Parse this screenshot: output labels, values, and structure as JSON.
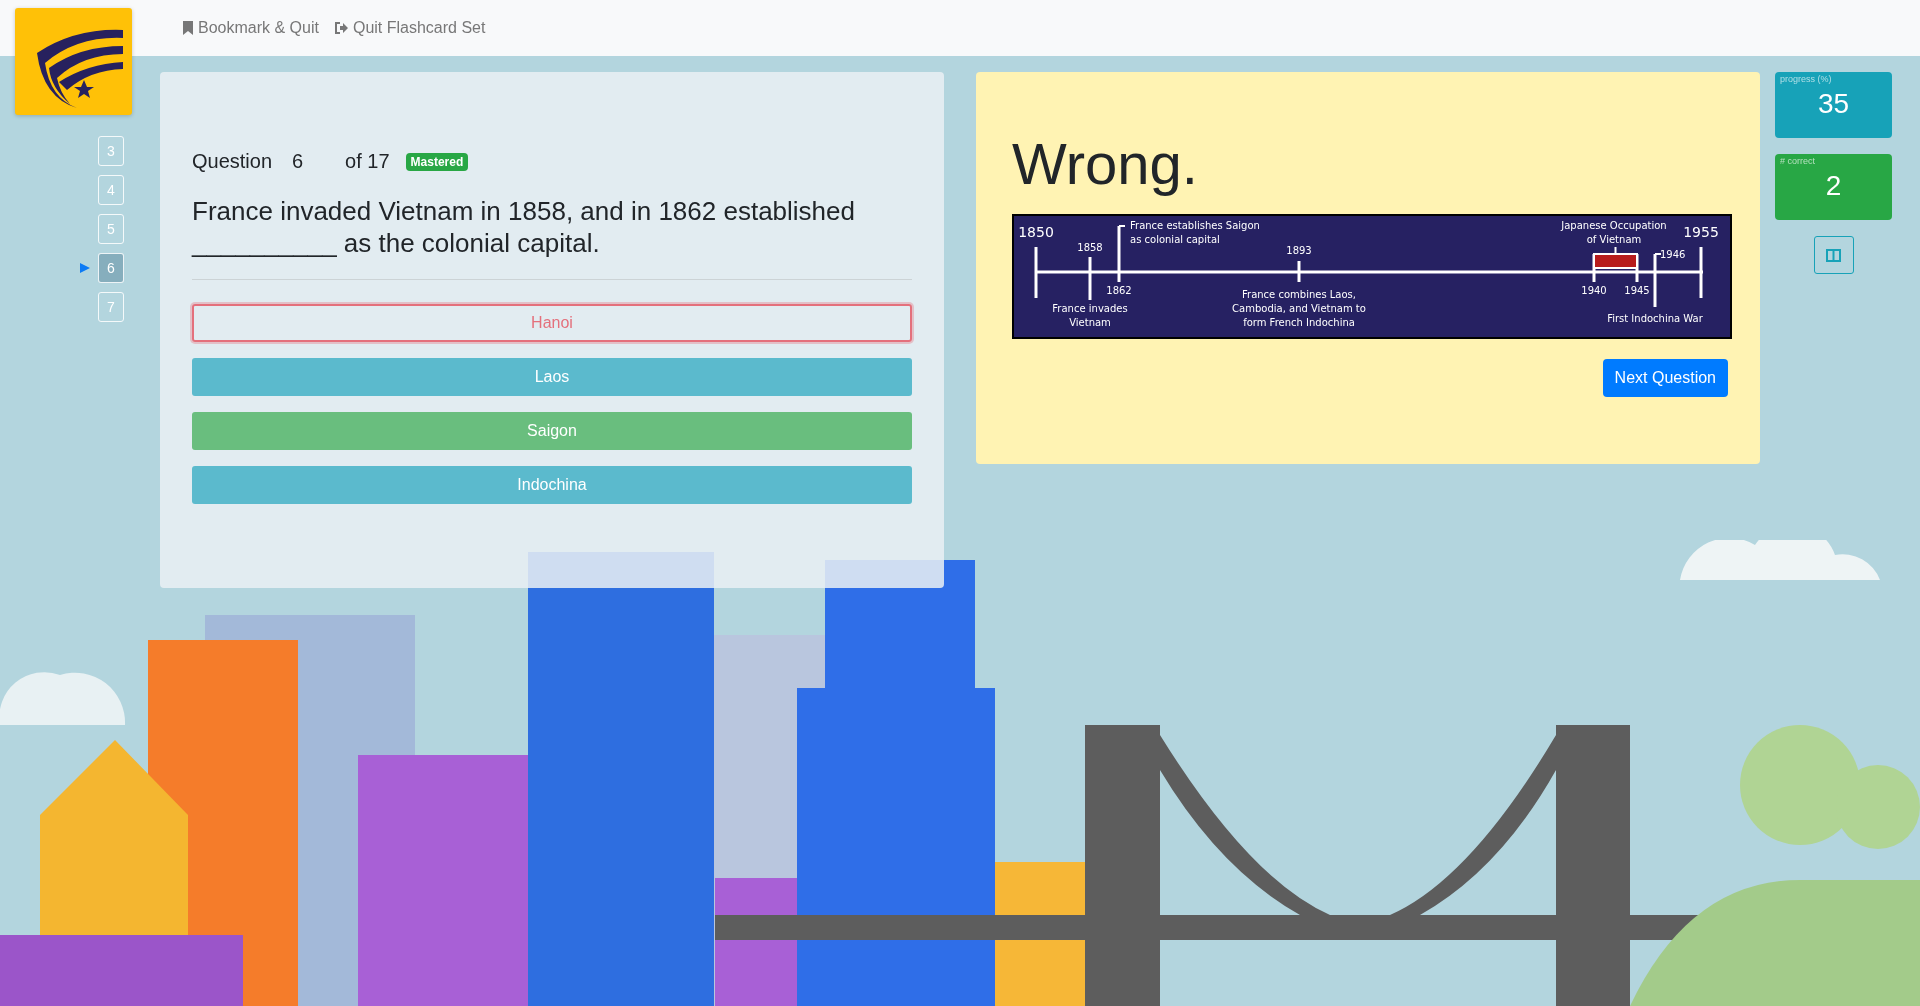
{
  "header": {
    "links": [
      {
        "label": "Bookmark & Quit",
        "kind": "bookmark"
      },
      {
        "label": "Quit Flashcard Set",
        "kind": "quit"
      }
    ]
  },
  "question_nav": [
    {
      "label": "3",
      "selected": false
    },
    {
      "label": "4",
      "selected": false
    },
    {
      "label": "5",
      "selected": false
    },
    {
      "label": "6",
      "selected": true
    },
    {
      "label": "7",
      "selected": false
    }
  ],
  "question": {
    "label": "Question",
    "number": "6",
    "total": "of 17",
    "badge": "Mastered",
    "text": "France invaded Vietnam in 1858, and in 1862 established __________ as the colonial capital.",
    "answers": [
      {
        "label": "Hanoi",
        "kind": "wrong"
      },
      {
        "label": "Laos",
        "kind": "option"
      },
      {
        "label": "Saigon",
        "kind": "correct"
      },
      {
        "label": "Indochina",
        "kind": "option"
      }
    ]
  },
  "feedback": {
    "verdict": "Wrong.",
    "button": "Next Question",
    "timeline": {
      "start": "1850",
      "end": "1955",
      "events": [
        {
          "years": [
            "1858"
          ],
          "caption": [
            "France invades",
            "Vietnam"
          ]
        },
        {
          "years": [
            "1862"
          ],
          "caption": [
            "France establishes Saigon",
            "as colonial capital"
          ]
        },
        {
          "years": [
            "1893"
          ],
          "caption": [
            "France combines Laos,",
            "Cambodia, and Vietnam to",
            "form French Indochina"
          ]
        },
        {
          "years": [
            "1940",
            "1945"
          ],
          "caption": [
            "Japanese Occupation",
            "of Vietnam"
          ]
        },
        {
          "years": [
            "1946"
          ],
          "caption": [
            "First Indochina War"
          ]
        }
      ]
    }
  },
  "stats": [
    {
      "label": "progress (%)",
      "value": "35",
      "color": "#17a2b8"
    },
    {
      "label": "# correct",
      "value": "2",
      "color": "#28a745"
    }
  ]
}
